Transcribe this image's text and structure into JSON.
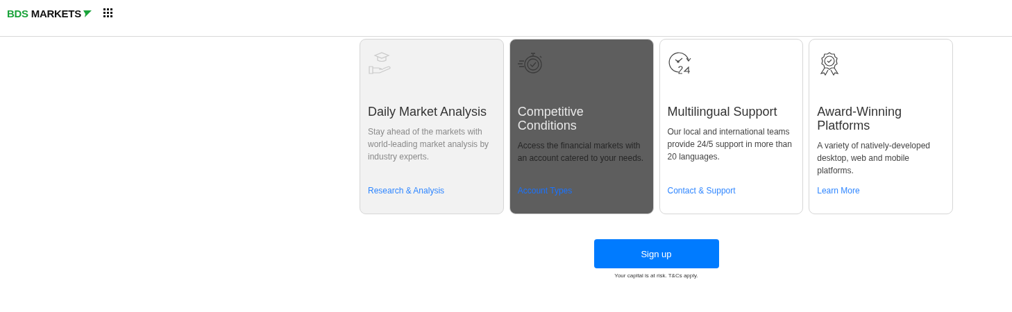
{
  "header": {
    "logo": {
      "brand": "BDS",
      "word": "MARKETS"
    }
  },
  "cards": [
    {
      "kind": "faded",
      "title": "Daily Market Analysis",
      "text": "Stay ahead of the markets with world-leading market analysis by industry experts.",
      "link": "Research & Analysis"
    },
    {
      "kind": "dark",
      "title": "Competitive Conditions",
      "text": "Access the financial markets with an account catered to your needs.",
      "link": "Account Types"
    },
    {
      "kind": "plain",
      "title": "Multilingual Support",
      "text": "Our local and international teams provide 24/5 support in more than 20 languages.",
      "link": "Contact & Support"
    },
    {
      "kind": "plain",
      "title": "Award-Winning Platforms",
      "text": "A variety of natively-developed desktop, web and mobile platforms.",
      "link": "Learn More"
    }
  ],
  "signup": {
    "button": "Sign up",
    "note": "Your capital is at risk. T&Cs apply."
  }
}
